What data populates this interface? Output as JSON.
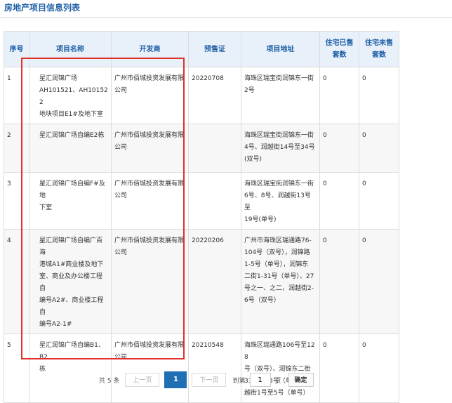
{
  "page": {
    "title": "房地产项目信息列表"
  },
  "table": {
    "headers": [
      "序号",
      "项目名称",
      "开发商",
      "预售证",
      "项目地址",
      "住宅已售\n套数",
      "住宅未售\n套数"
    ],
    "rows": [
      [
        "1",
        "星汇润锦广场\nAH101521、AH101522\n地块项目E1#及地下室",
        "广州市佰城投资发展有限\n公司",
        "20220708",
        "海珠区瑞宝街润锦东一街\n2号",
        "0",
        "0"
      ],
      [
        "2",
        "星汇润锦广场自编E2栋",
        "广州市佰城投资发展有限\n公司",
        "",
        "海珠区瑞宝街润锦东一街\n4号、润越街14号至34号\n(双号)",
        "0",
        "0"
      ],
      [
        "3",
        "星汇润锦广场自编F#及地\n下室",
        "广州市佰城投资发展有限\n公司",
        "",
        "海珠区瑞宝街润锦东一街\n6号、8号、润越街13号至\n19号(单号)",
        "0",
        "0"
      ],
      [
        "4",
        "星汇润锦广场自编广百海\n港城A1#商业楼及地下\n室、商业及办公楼工程自\n编号A2#、商业楼工程自\n编号A2-1#",
        "广州市佰城投资发展有限\n公司",
        "20220206",
        "广州市海珠区瑞通路76-\n104号（双号），润锦路\n1-5号（单号），润锦东\n二街1-31号（单号）、27\n号之一、之二，润越街2-\n6号（双号）",
        "0",
        "0"
      ],
      [
        "5",
        "星汇润锦广场自编B1、B2\n栋",
        "广州市佰城投资发展有限\n公司",
        "20210548",
        "海珠区瑞通路106号至128\n号（双号）、润锦东二街\n33号至63号（单号）、润\n越街1号至5号（单号）",
        "0",
        "0"
      ]
    ]
  },
  "pagination": {
    "total_text": "共 5 条",
    "prev_label": "上一页",
    "current_page": "1",
    "next_label": "下一页",
    "goto_label": "到第",
    "goto_value": "1",
    "page_unit": "页",
    "confirm_label": "确定"
  }
}
